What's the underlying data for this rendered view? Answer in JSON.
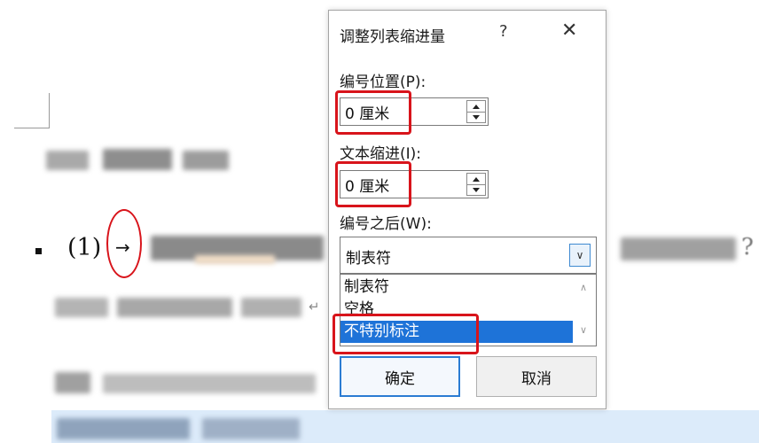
{
  "document": {
    "list_number": "(1)",
    "tab_arrow": "→",
    "trailing_mark": "?",
    "paragraph_mark": "↵"
  },
  "dialog": {
    "title": "调整列表缩进量",
    "help_label": "?",
    "close_label": "✕",
    "number_position": {
      "label": "编号位置(P):",
      "value": "0 厘米"
    },
    "text_indent": {
      "label": "文本缩进(I):",
      "value": "0 厘米"
    },
    "follow_number": {
      "label": "编号之后(W):",
      "selected": "制表符",
      "options": [
        "制表符",
        "空格",
        "不特别标注"
      ],
      "highlighted": "不特别标注"
    },
    "ok_label": "确定",
    "cancel_label": "取消"
  },
  "colors": {
    "annotation_red": "#d8141b",
    "selection_blue": "#1e73d8",
    "focus_blue": "#2b7cd3"
  }
}
